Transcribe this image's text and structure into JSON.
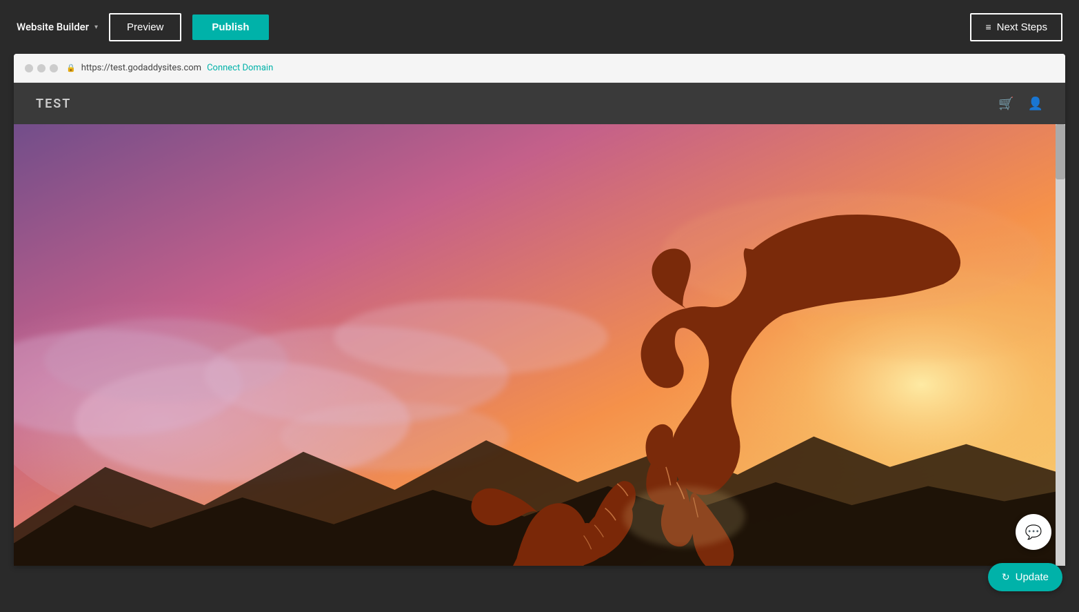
{
  "toolbar": {
    "brand_label": "Website Builder",
    "brand_chevron": "▾",
    "preview_label": "Preview",
    "publish_label": "Publish",
    "next_steps_label": "Next Steps",
    "next_steps_icon": "≡"
  },
  "browser": {
    "url": "https://test.godaddysites.com",
    "connect_domain_label": "Connect Domain",
    "lock_icon": "🔒"
  },
  "site": {
    "logo": "TEST",
    "cart_icon": "🛒",
    "user_icon": "👤"
  },
  "chat_button": {
    "icon": "💬"
  },
  "update_button": {
    "label": "Update",
    "icon": "↻"
  },
  "colors": {
    "toolbar_bg": "#2a2a2a",
    "teal": "#00b2a9",
    "preview_border": "#ffffff",
    "nav_bg": "#3a3a3a"
  }
}
